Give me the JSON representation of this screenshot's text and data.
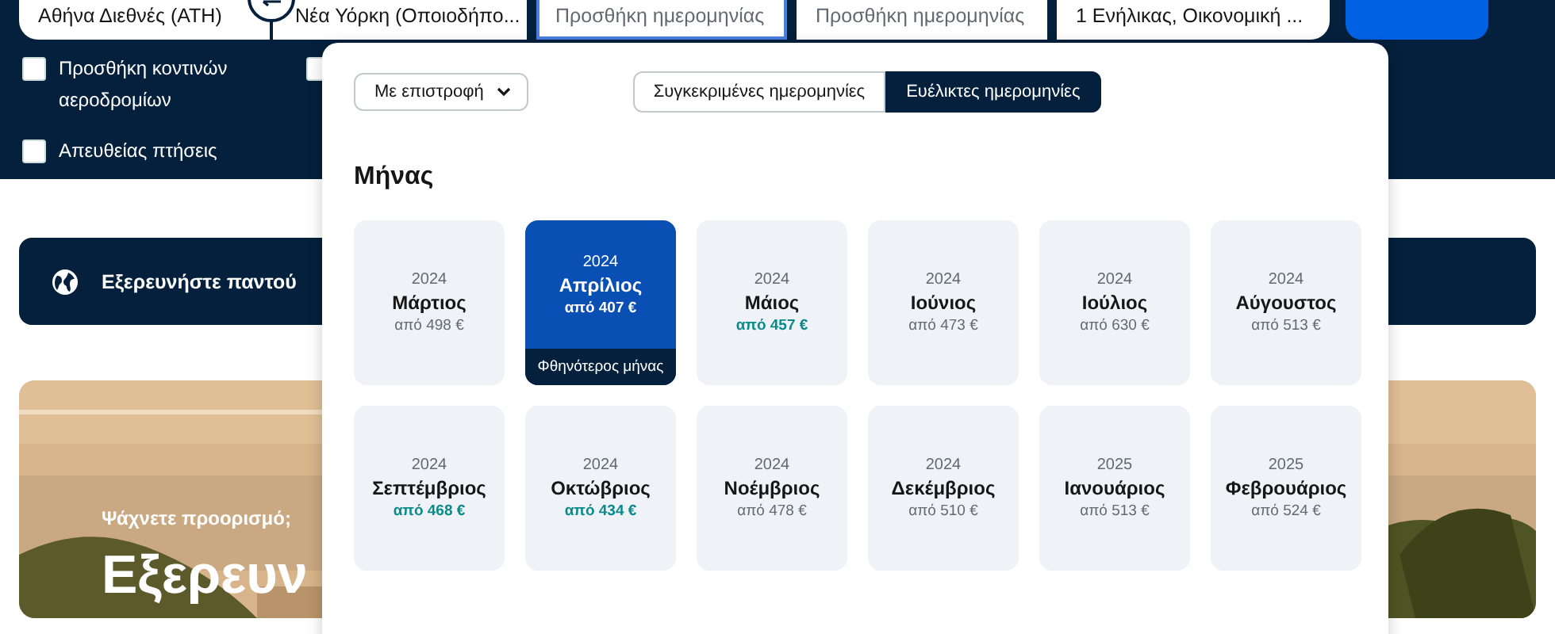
{
  "search": {
    "origin": "Αθήνα Διεθνές (ATH)",
    "destination": "Νέα Υόρκη (Οποιοδήπο...",
    "depart_placeholder": "Προσθήκη ημερομηνίας",
    "return_placeholder": "Προσθήκη ημερομηνίας",
    "passengers": "1 Ενήλικας, Οικονομική ..."
  },
  "options": [
    {
      "label": "Προσθήκη κοντινών αεροδρομίων",
      "checked": false
    },
    {
      "label": "Απευθείας πτήσεις",
      "checked": false
    },
    {
      "checked": false
    }
  ],
  "explore": {
    "label": "Εξερευνήστε παντού"
  },
  "hero": {
    "subtitle": "Ψάχνετε προορισμό;",
    "title": "Εξερευν"
  },
  "date_popup": {
    "trip_type": "Με επιστροφή",
    "modes": [
      {
        "label": "Συγκεκριμένες ημερομηνίες",
        "selected": false
      },
      {
        "label": "Ευέλικτες ημερομηνίες",
        "selected": true
      }
    ],
    "heading": "Μήνας",
    "months": [
      {
        "year": "2024",
        "month": "Μάρτιος",
        "price": "από 498 €",
        "selected": false,
        "cheap": false
      },
      {
        "year": "2024",
        "month": "Απρίλιος",
        "price": "από 407 €",
        "selected": true,
        "cheap": true,
        "badge": "Φθηνότερος μήνας"
      },
      {
        "year": "2024",
        "month": "Μάιος",
        "price": "από 457 €",
        "selected": false,
        "cheap": true
      },
      {
        "year": "2024",
        "month": "Ιούνιος",
        "price": "από 473 €",
        "selected": false,
        "cheap": false
      },
      {
        "year": "2024",
        "month": "Ιούλιος",
        "price": "από 630 €",
        "selected": false,
        "cheap": false
      },
      {
        "year": "2024",
        "month": "Αύγουστος",
        "price": "από 513 €",
        "selected": false,
        "cheap": false
      },
      {
        "year": "2024",
        "month": "Σεπτέμβριος",
        "price": "από 468 €",
        "selected": false,
        "cheap": true
      },
      {
        "year": "2024",
        "month": "Οκτώβριος",
        "price": "από 434 €",
        "selected": false,
        "cheap": true
      },
      {
        "year": "2024",
        "month": "Νοέμβριος",
        "price": "από 478 €",
        "selected": false,
        "cheap": false
      },
      {
        "year": "2024",
        "month": "Δεκέμβριος",
        "price": "από 510 €",
        "selected": false,
        "cheap": false
      },
      {
        "year": "2025",
        "month": "Ιανουάριος",
        "price": "από 513 €",
        "selected": false,
        "cheap": false
      },
      {
        "year": "2025",
        "month": "Φεβρουάριος",
        "price": "από 524 €",
        "selected": false,
        "cheap": false
      }
    ]
  }
}
